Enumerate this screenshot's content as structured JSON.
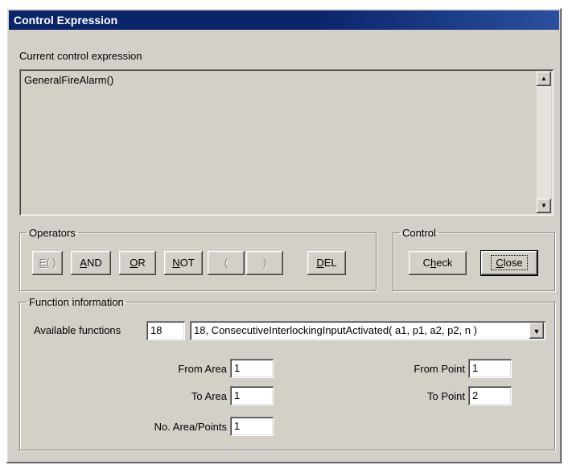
{
  "window": {
    "title": "Control Expression"
  },
  "expression": {
    "label": "Current control expression",
    "value": "GeneralFireAlarm()"
  },
  "scroll": {
    "up_icon": "arrow-up",
    "down_icon": "arrow-down"
  },
  "operators": {
    "legend": "Operators",
    "buttons": [
      {
        "pre": "",
        "u": "E",
        "post": "( )"
      },
      {
        "pre": "",
        "u": "A",
        "post": "ND"
      },
      {
        "pre": "",
        "u": "O",
        "post": "R"
      },
      {
        "pre": "",
        "u": "N",
        "post": "OT"
      },
      {
        "pre": "(",
        "u": "",
        "post": ""
      },
      {
        "pre": ")",
        "u": "",
        "post": ""
      },
      {
        "pre": "",
        "u": "D",
        "post": "EL"
      }
    ]
  },
  "control": {
    "legend": "Control",
    "check": {
      "pre": "C",
      "u": "h",
      "post": "eck"
    },
    "close": {
      "pre": "",
      "u": "C",
      "post": "lose"
    }
  },
  "function_info": {
    "legend": "Function information",
    "available_label": "Available functions",
    "available_count": "18",
    "selected_function": "18, ConsecutiveInterlockingInputActivated( a1, p1, a2, p2, n )",
    "from_area_label": "From Area",
    "from_area": "1",
    "to_area_label": "To Area",
    "to_area": "1",
    "no_area_points_label": "No. Area/Points",
    "no_area_points": "1",
    "from_point_label": "From Point",
    "from_point": "1",
    "to_point_label": "To Point",
    "to_point": "2"
  }
}
